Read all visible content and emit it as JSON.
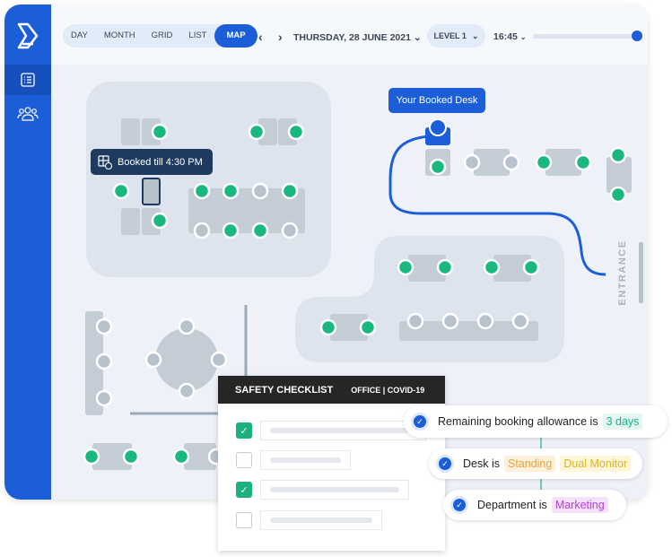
{
  "nav": {
    "views": [
      "DAY",
      "MONTH",
      "GRID",
      "LIST",
      "MAP"
    ],
    "active_view": "MAP",
    "date": "THURSDAY, 28 JUNE 2021",
    "level": "LEVEL 1",
    "time": "16:45",
    "time_slider_percent": 95
  },
  "sidebar": {
    "items": [
      {
        "icon": "list-icon",
        "selected": true
      },
      {
        "icon": "people-icon",
        "selected": false
      }
    ]
  },
  "map": {
    "your_desk_label": "Your Booked Desk",
    "booked_tooltip": "Booked till 4:30 PM",
    "entrance_label": "ENTRANCE"
  },
  "checklist": {
    "title": "SAFETY CHECKLIST",
    "subtitle": "OFFICE | COVID-19",
    "items": [
      {
        "checked": true
      },
      {
        "checked": false
      },
      {
        "checked": true
      },
      {
        "checked": false
      }
    ]
  },
  "rules": [
    {
      "text": "Remaining booking allowance is",
      "tags": [
        "3 days"
      ]
    },
    {
      "text": "Desk is",
      "tags": [
        "Standing",
        "Dual Monitor"
      ]
    },
    {
      "text": "Department is",
      "tags": [
        "Marketing"
      ]
    }
  ],
  "colors": {
    "accent": "#1c5ed8",
    "available": "#1ab87f",
    "occupied": "#b8c2cc",
    "tag_days": "#1ab08f",
    "tag_standing": "#e8a23a",
    "tag_monitor": "#d9b324",
    "tag_marketing": "#b53fd6"
  }
}
